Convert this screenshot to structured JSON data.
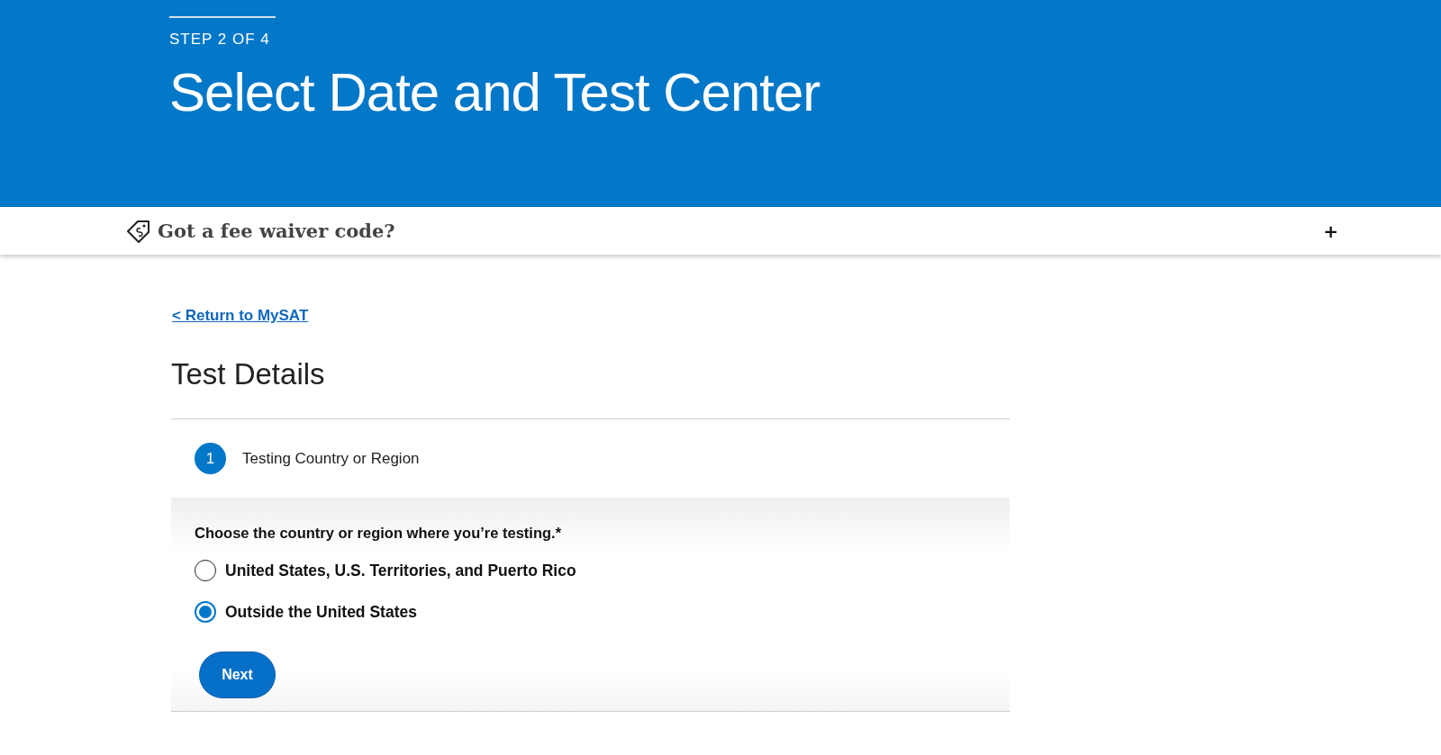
{
  "header": {
    "step": "STEP 2 OF 4",
    "title": "Select Date and Test Center"
  },
  "fee_waiver": {
    "label": "Got a fee waiver code?",
    "toggle": "+"
  },
  "return_link": "< Return to MySAT",
  "section_title": "Test Details",
  "step_section": {
    "number": "1",
    "title": "Testing Country or Region"
  },
  "question": "Choose the country or region where you’re testing.*",
  "options": [
    {
      "label": "United States, U.S. Territories, and Puerto Rico",
      "selected": false
    },
    {
      "label": "Outside the United States",
      "selected": true
    }
  ],
  "next_button": "Next"
}
